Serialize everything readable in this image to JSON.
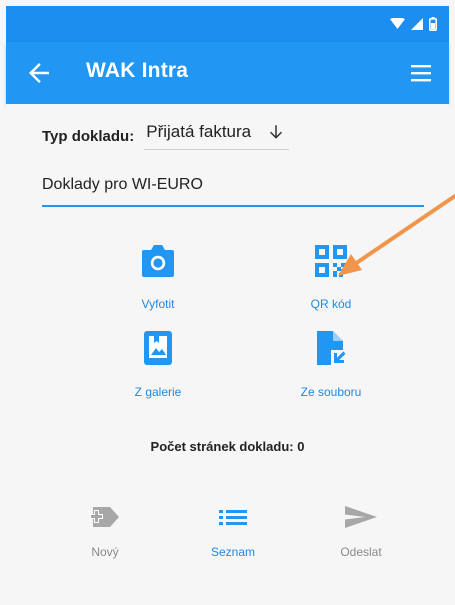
{
  "app_bar": {
    "title": "WAK Intra",
    "back_icon": "arrow-left-icon",
    "menu_icon": "hamburger-menu-icon"
  },
  "status_bar": {
    "icons": [
      "wifi-icon",
      "cellular-signal-icon",
      "battery-icon"
    ]
  },
  "form": {
    "doc_type_label": "Typ dokladu:",
    "doc_type_value": "Přijatá faktura",
    "text_value": "Doklady pro WI-EURO"
  },
  "actions": {
    "photo": "Vyfotit",
    "qr": "QR kód",
    "gallery": "Z galerie",
    "file": "Ze souboru"
  },
  "pages_count": "Počet stránek dokladu: 0",
  "bottom_nav": {
    "new": "Nový",
    "list": "Seznam",
    "send": "Odeslat"
  },
  "colors": {
    "primary": "#2196f3",
    "status_bar": "#1c8ef0",
    "label_blue": "#1e88e5",
    "disabled_grey": "#9e9e9e",
    "annotation_arrow": "#f0954a"
  }
}
